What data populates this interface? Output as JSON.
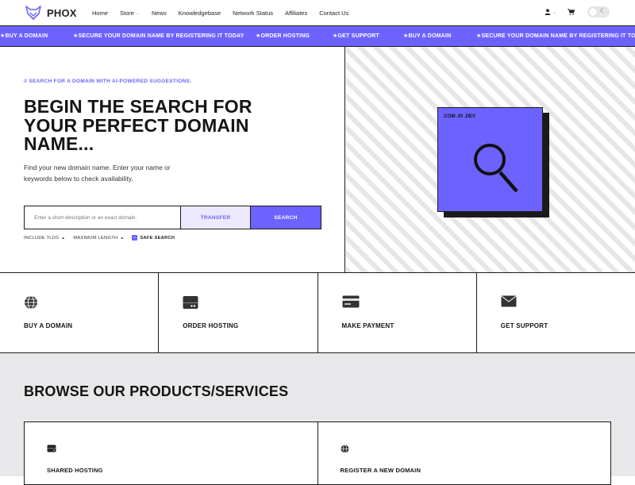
{
  "brand": {
    "name": "PHOX",
    "accent": "#6c63ff"
  },
  "nav": {
    "items": [
      {
        "label": "Home",
        "dropdown": false
      },
      {
        "label": "Store",
        "dropdown": true
      },
      {
        "label": "News",
        "dropdown": false
      },
      {
        "label": "Knowledgebase",
        "dropdown": false
      },
      {
        "label": "Network Status",
        "dropdown": false
      },
      {
        "label": "Affiliates",
        "dropdown": false
      },
      {
        "label": "Contact Us",
        "dropdown": false
      }
    ]
  },
  "header_right": {
    "user_icon": "user-icon",
    "cart_icon": "cart-icon",
    "theme_toggle_icon": "moon-icon"
  },
  "ticker": {
    "items": [
      "★BUY A DOMAIN",
      "★SECURE YOUR DOMAIN NAME BY REGISTERING IT TODAY",
      "★ORDER HOSTING",
      "★GET SUPPORT",
      "★BUY A DOMAIN",
      "★SECURE YOUR DOMAIN NAME BY REGISTERING IT TODAY"
    ]
  },
  "hero": {
    "tagline": "// SEARCH FOR A DOMAIN WITH AI-POWERED SUGGESTIONS.",
    "title": "BEGIN THE SEARCH FOR YOUR PERFECT DOMAIN NAME...",
    "description": "Find your new domain name. Enter your name or keywords below to check availability.",
    "search_placeholder": "Enter a short description or an exact domain.",
    "transfer_label": "TRANSFER",
    "search_label": "SEARCH",
    "options": {
      "include_tlds": "INCLUDE TLDS",
      "max_length": "MAXIMUM LENGTH",
      "safe_search": "SAFE SEARCH",
      "safe_search_checked": true
    },
    "card_label": ".COM .IO .DEV"
  },
  "quick_links": [
    {
      "label": "BUY A DOMAIN",
      "icon": "globe-icon"
    },
    {
      "label": "ORDER HOSTING",
      "icon": "server-icon"
    },
    {
      "label": "MAKE PAYMENT",
      "icon": "credit-card-icon"
    },
    {
      "label": "GET SUPPORT",
      "icon": "envelope-icon"
    }
  ],
  "products": {
    "title": "BROWSE OUR PRODUCTS/SERVICES",
    "items": [
      {
        "label": "SHARED HOSTING",
        "icon": "server-icon"
      },
      {
        "label": "REGISTER A NEW DOMAIN",
        "icon": "globe-icon"
      }
    ]
  }
}
